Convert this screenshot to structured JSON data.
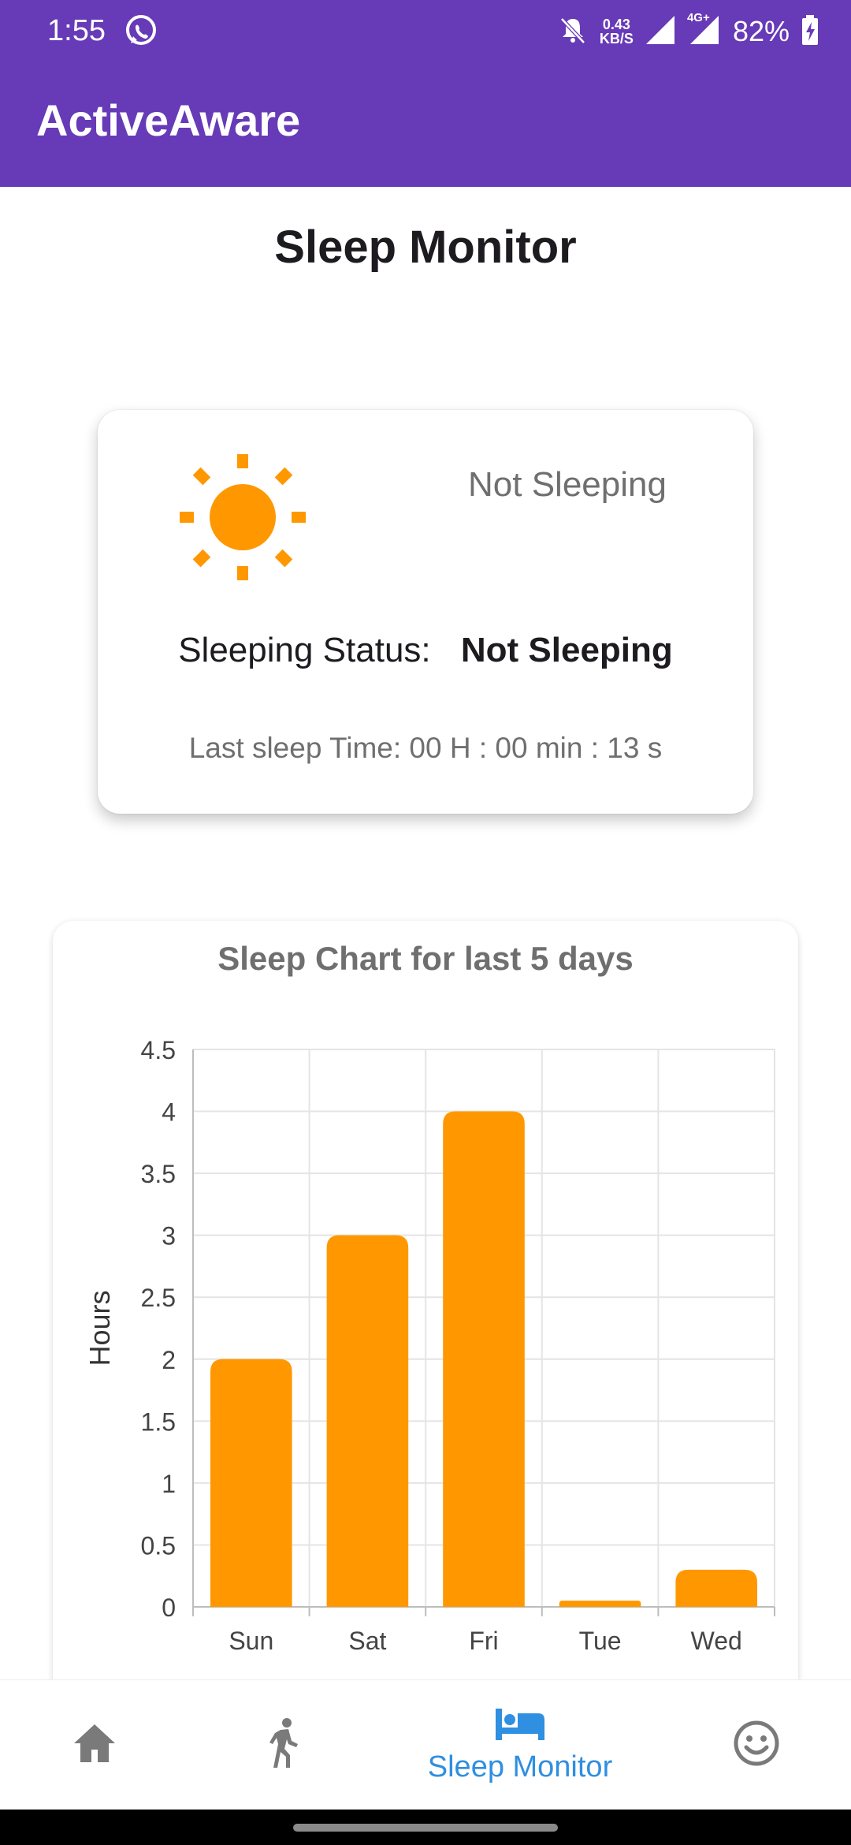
{
  "status_bar": {
    "time": "1:55",
    "net_speed_value": "0.43",
    "net_speed_unit": "KB/S",
    "network": "4G+",
    "battery": "82%"
  },
  "app_bar": {
    "title": "ActiveAware"
  },
  "page": {
    "title": "Sleep Monitor"
  },
  "status_card": {
    "icon": "sun-icon",
    "state_text": "Not Sleeping",
    "status_label": "Sleeping Status:",
    "status_value": "Not Sleeping",
    "last_sleep": "Last sleep Time: 00 H : 00 min : 13 s"
  },
  "colors": {
    "primary": "#673ab7",
    "accent_orange": "#ff9800",
    "nav_active": "#2f8fe0",
    "nav_inactive": "#7a7a7a"
  },
  "chart_data": {
    "type": "bar",
    "title": "Sleep Chart for last 5 days",
    "ylabel": "Hours",
    "xlabel": "",
    "categories": [
      "Sun",
      "Sat",
      "Fri",
      "Tue",
      "Wed"
    ],
    "values": [
      2,
      3,
      4,
      0.05,
      0.3
    ],
    "ylim": [
      0,
      4.5
    ],
    "yticks": [
      "0",
      "0.5",
      "1",
      "1.5",
      "2",
      "2.5",
      "3",
      "3.5",
      "4",
      "4.5"
    ],
    "grid": true,
    "bar_color": "#ff9800"
  },
  "bottom_nav": {
    "items": [
      {
        "icon": "home-icon",
        "label": ""
      },
      {
        "icon": "walking-icon",
        "label": ""
      },
      {
        "icon": "bed-icon",
        "label": "Sleep Monitor"
      },
      {
        "icon": "smiley-icon",
        "label": ""
      }
    ]
  }
}
